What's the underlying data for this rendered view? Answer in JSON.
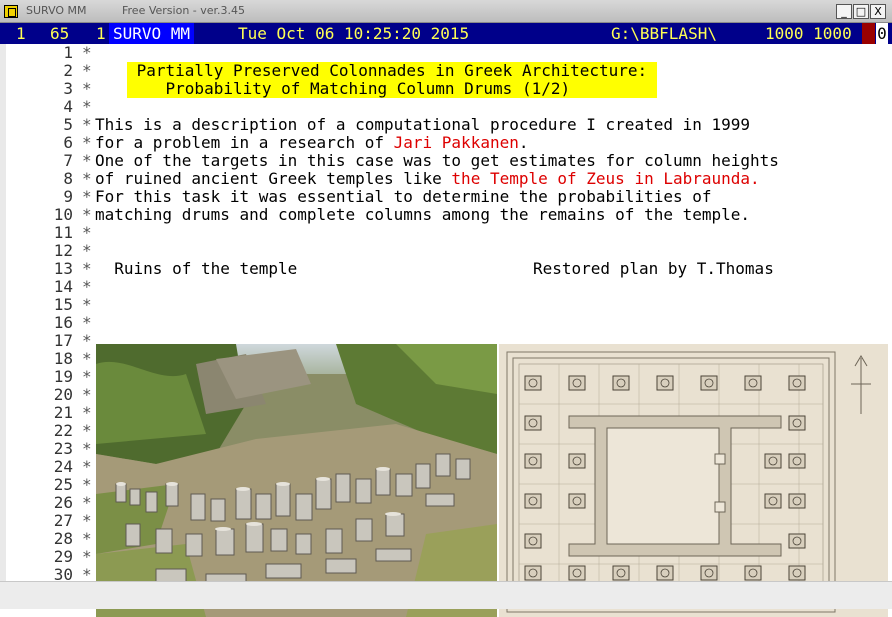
{
  "window": {
    "title": "SURVO MM",
    "version": "Free Version  -  ver.3.45",
    "buttons": {
      "minimize": "_",
      "maximize": "□",
      "close": "X"
    }
  },
  "status": {
    "row": "1",
    "col": "65",
    "col_suffix": "1",
    "mode": "SURVO MM",
    "datetime": "Tue Oct 06 10:25:20 2015",
    "path": "G:\\BBFLASH\\",
    "dims": "1000 1000",
    "zero": "0"
  },
  "editor": {
    "line_numbers": [
      "1",
      "2",
      "3",
      "4",
      "5",
      "6",
      "7",
      "8",
      "9",
      "10",
      "11",
      "12",
      "13",
      "14",
      "15",
      "16",
      "17",
      "18",
      "19",
      "20",
      "21",
      "22",
      "23",
      "24",
      "25",
      "26",
      "27",
      "28",
      "29",
      "30"
    ],
    "star": "*",
    "title_line1": " Partially Preserved Colonnades in Greek Architecture: ",
    "title_line2": "    Probability of Matching Column Drums (1/2)         ",
    "l5": "This is a description of a computational procedure I created in 1999",
    "l6_a": "for a problem in a research of ",
    "l6_red": "Jari Pakkanen",
    "l6_b": ".",
    "l7": "One of the targets in this case was to get estimates for column heights",
    "l8_a": "of ruined ancient Greek temples like ",
    "l8_red": "the Temple of Zeus in Labraunda.",
    "l9": "For this task it was essential to determine the probabilities of",
    "l10": "matching drums and complete columns among the remains of the temple.",
    "l13_left": "  Ruins of the temple",
    "l13_right": "Restored plan by T.Thomas"
  },
  "colors": {
    "status_bg": "#00008a",
    "status_fg": "#ffff55",
    "mode_bg": "#0000ff",
    "highlight": "#ffff00",
    "link_red": "#dd0000"
  }
}
